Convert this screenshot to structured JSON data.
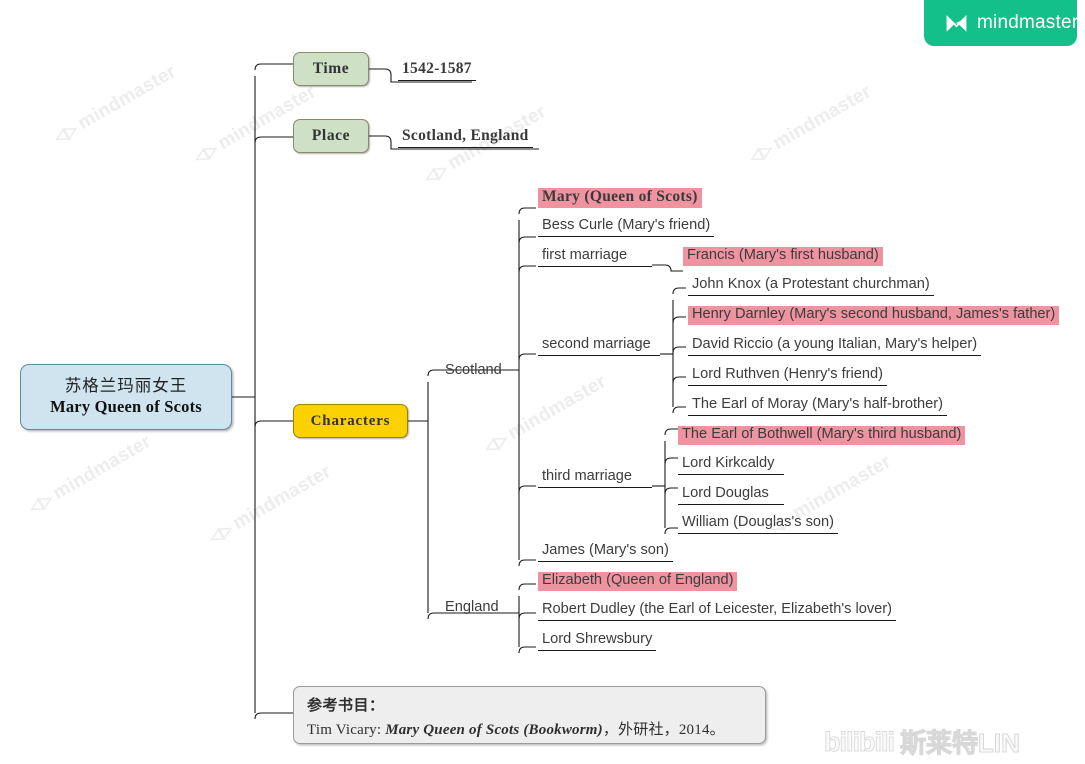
{
  "app": {
    "logo_text": "mindmaster",
    "logo_icon": "mindmaster-bowtie-icon",
    "logo_color": "#13c08a",
    "watermark_text": "mindmaster"
  },
  "overlay": {
    "bili_logo_text": "bilibili",
    "bili_user": "斯莱特LIN"
  },
  "colors": {
    "root_fill": "#cfe4ef",
    "green_fill": "#cee1c6",
    "yellow_fill": "#fbd200",
    "pink_highlight": "#ef93a0",
    "ref_fill": "#eeeeee",
    "line": "#1a1a1a"
  },
  "root": {
    "title_cn": "苏格兰玛丽女王",
    "title_en": "Mary Queen of Scots"
  },
  "branches": {
    "time": {
      "label": "Time",
      "value": "1542-1587"
    },
    "place": {
      "label": "Place",
      "value": "Scotland, England"
    },
    "characters": {
      "label": "Characters"
    }
  },
  "scotland": {
    "label": "Scotland",
    "items": [
      {
        "text": "Mary (Queen of Scots)",
        "highlight": true,
        "style": "serif"
      },
      {
        "text": "Bess Curle (Mary's friend)",
        "highlight": false
      },
      {
        "text": "first marriage",
        "highlight": false
      },
      {
        "text": "second marriage",
        "highlight": false
      },
      {
        "text": "third marriage",
        "highlight": false
      },
      {
        "text": "James (Mary's son)",
        "highlight": false
      }
    ],
    "first_marriage_children": [
      {
        "text": "Francis (Mary's first husband)",
        "highlight": true
      }
    ],
    "second_marriage_children": [
      {
        "text": "John Knox (a Protestant churchman)",
        "highlight": false
      },
      {
        "text": "Henry Darnley (Mary's second husband, James's father)",
        "highlight": true
      },
      {
        "text": "David Riccio (a young Italian, Mary's helper)",
        "highlight": false
      },
      {
        "text": "Lord Ruthven (Henry's friend)",
        "highlight": false
      },
      {
        "text": "The Earl of Moray (Mary's half-brother)",
        "highlight": false
      }
    ],
    "third_marriage_children": [
      {
        "text": "The Earl of Bothwell (Mary's third husband)",
        "highlight": true
      },
      {
        "text": "Lord Kirkcaldy",
        "highlight": false
      },
      {
        "text": "Lord Douglas",
        "highlight": false
      },
      {
        "text": "William (Douglas's son)",
        "highlight": false
      }
    ]
  },
  "england": {
    "label": "England",
    "items": [
      {
        "text": "Elizabeth (Queen of England)",
        "highlight": true
      },
      {
        "text": "Robert Dudley (the Earl of Leicester, Elizabeth's lover)",
        "highlight": false
      },
      {
        "text": "Lord Shrewsbury",
        "highlight": false
      }
    ]
  },
  "reference": {
    "heading": "参考书目：",
    "author": "Tim Vicary: ",
    "title_italic": "Mary Queen of Scots (Bookworm)",
    "tail": "，外研社，2014。"
  }
}
